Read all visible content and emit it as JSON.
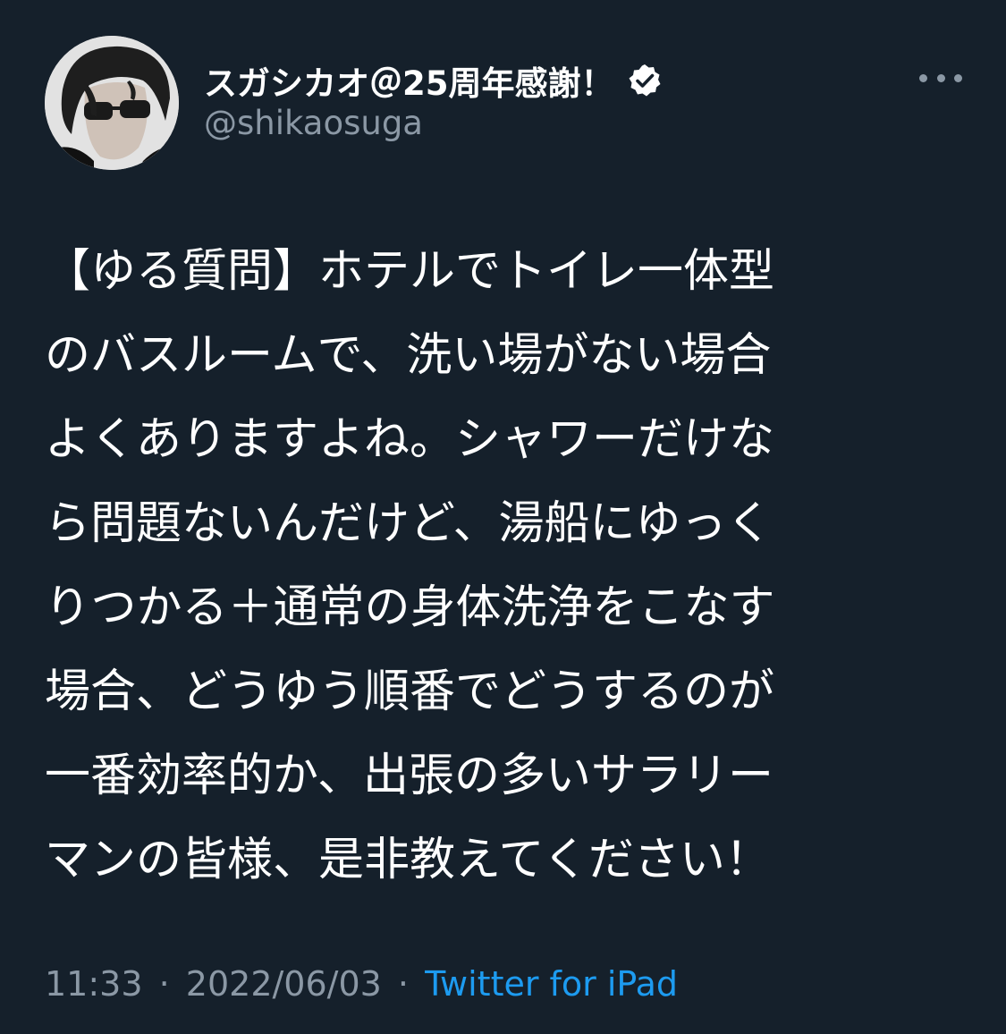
{
  "tweet": {
    "display_name": "スガシカオ＠25周年感謝！",
    "handle": "@shikaosuga",
    "verified_icon": "verified-badge-icon",
    "more_icon": "more-options-icon",
    "body_lines": [
      "【ゆる質問】ホテルでトイレ一体型",
      "のバスルームで、洗い場がない場合",
      "よくありますよね。シャワーだけな",
      "ら問題ないんだけど、湯船にゆっく",
      "りつかる＋通常の身体洗浄をこなす",
      "場合、どうゆう順番でどうするのが",
      "一番効率的か、出張の多いサラリー",
      "マンの皆様、是非教えてください！"
    ],
    "time": "11:33",
    "separator": "·",
    "date": "2022/06/03",
    "source": "Twitter for iPad"
  },
  "colors": {
    "background": "#15202b",
    "text_primary": "#ffffff",
    "text_secondary": "#8b98a5",
    "link": "#1d9bf0"
  }
}
